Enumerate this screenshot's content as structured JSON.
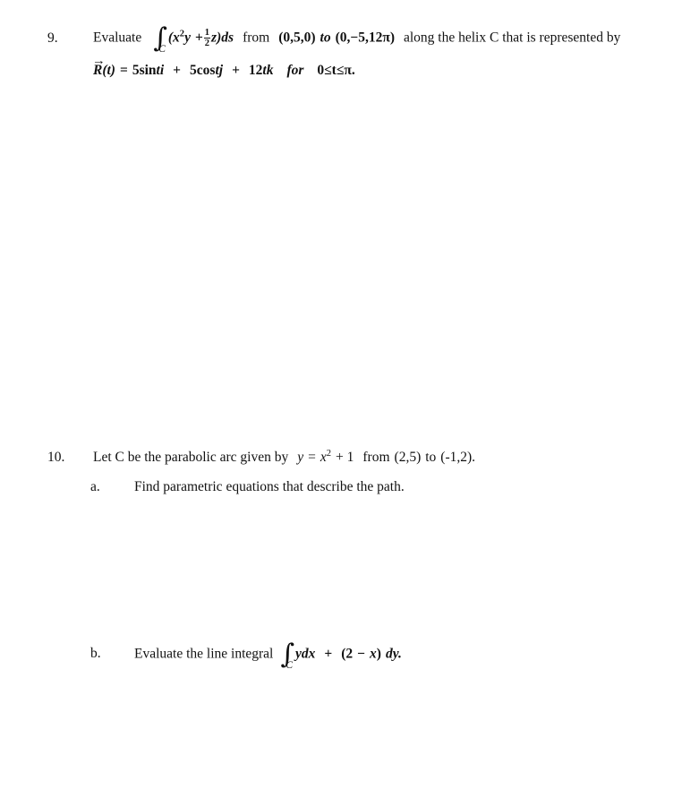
{
  "document": {
    "type": "math-worksheet",
    "background_color": "#ffffff",
    "text_color": "#111111"
  },
  "problems": [
    {
      "number": "9.",
      "line1": {
        "before_integral": "Evaluate",
        "integral_subscript": "C",
        "integrand_open": "(",
        "integrand_x": "x",
        "integrand_x_exp": "2",
        "integrand_y": "y",
        "plus": "+",
        "frac_num": "1",
        "frac_den": "2",
        "integrand_z": "z",
        "integrand_close": ")",
        "differential": "ds",
        "from_word": "from",
        "point_start": "(0,5,0)",
        "to_word": "to",
        "point_end": "(0,−5,12π)",
        "after_points": "along the helix C that is represented by"
      },
      "line2": {
        "vector_name": "R",
        "vector_arg": "(t)",
        "equals": "=",
        "term1_coeff": "5sin",
        "term1_var": "t",
        "term1_unit": "i",
        "plus1": "+",
        "term2_coeff": "5cos",
        "term2_var": "t",
        "term2_unit": "j",
        "plus2": "+",
        "term3_coeff": "12",
        "term3_var": "t",
        "term3_unit": "k",
        "for_word": "for",
        "domain": "0≤t≤π."
      }
    },
    {
      "number": "10.",
      "line1": {
        "text_before": "Let C be the parabolic arc given by",
        "eq_y": "y",
        "eq_equals": "=",
        "eq_x": "x",
        "eq_exp": "2",
        "eq_plus_one": "+ 1",
        "from_word": "from",
        "point_start": "(2,5)",
        "to_word": "to",
        "point_end": "(-1,2)."
      },
      "subitems": [
        {
          "letter": "a.",
          "text": "Find parametric equations that describe the path."
        },
        {
          "letter": "b.",
          "text_before": "Evaluate the line integral",
          "integral_subscript": "C",
          "term1_y": "y",
          "term1_dx": "dx",
          "plus": "+",
          "term2_open": "(2",
          "term2_minus": "−",
          "term2_x": "x",
          "term2_close": ")",
          "term2_dy": "dy."
        }
      ]
    }
  ]
}
